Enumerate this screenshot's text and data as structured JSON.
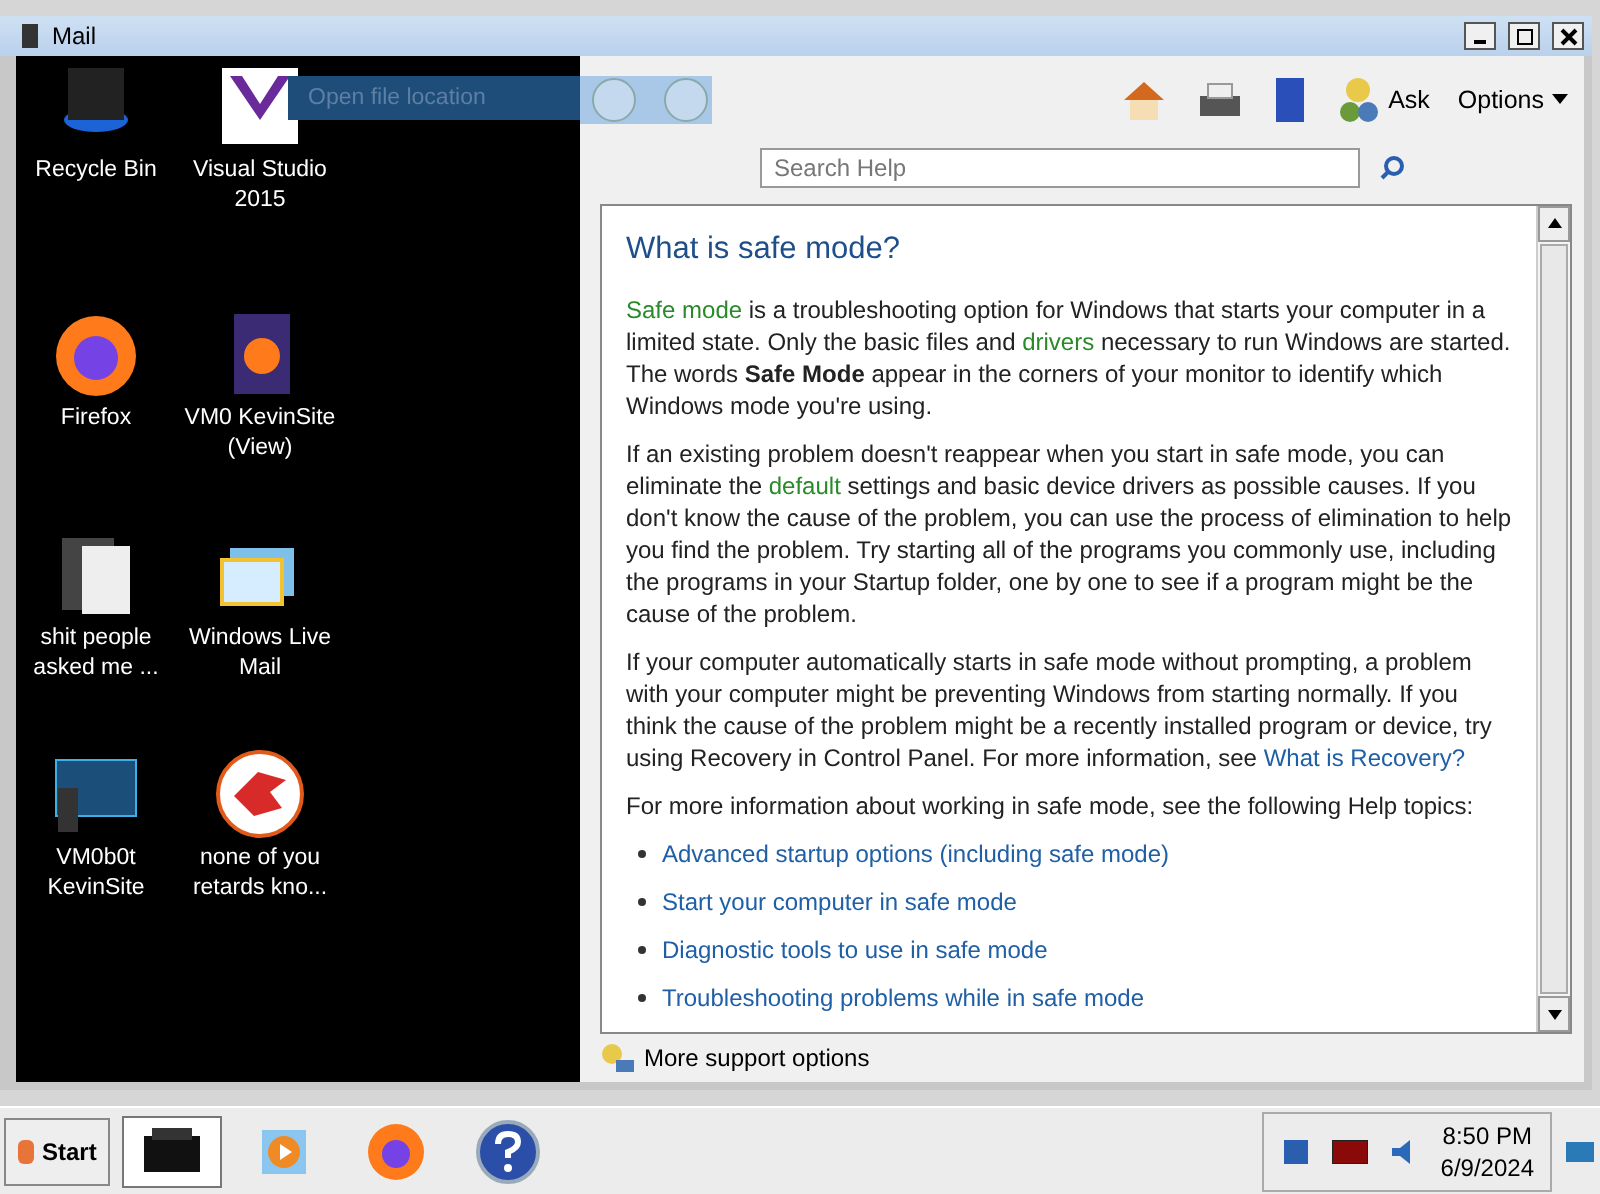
{
  "window": {
    "title": "Mail"
  },
  "desktop": {
    "drag_label": "Open file location",
    "icons": [
      {
        "label": "Recycle Bin",
        "kind": "bin"
      },
      {
        "label": "Visual Studio 2015",
        "kind": "vs"
      },
      {
        "label": "Firefox",
        "kind": "firefox"
      },
      {
        "label": "VM0 KevinSite (View)",
        "kind": "doc"
      },
      {
        "label": "shit people asked me ...",
        "kind": "folder"
      },
      {
        "label": "Windows Live Mail",
        "kind": "mail"
      },
      {
        "label": "VM0b0t KevinSite",
        "kind": "monitor"
      },
      {
        "label": "none of you retards kno...",
        "kind": "dino"
      }
    ]
  },
  "help": {
    "toolbar": {
      "ask": "Ask",
      "options": "Options"
    },
    "search": {
      "placeholder": "Search Help"
    },
    "heading": "What is safe mode?",
    "paragraphs": [
      [
        {
          "kind": "term",
          "text": "Safe mode"
        },
        {
          "kind": "plain",
          "text": " is a troubleshooting option for Windows that starts your computer in a limited state. Only the basic files and "
        },
        {
          "kind": "term",
          "text": "drivers"
        },
        {
          "kind": "plain",
          "text": " necessary to run Windows are started. The words **Safe Mode** appear in the corners of your monitor to identify which Windows mode you're using."
        }
      ],
      [
        {
          "kind": "plain",
          "text": "If an existing problem doesn't reappear when you start in safe mode, you can eliminate the "
        },
        {
          "kind": "term",
          "text": "default"
        },
        {
          "kind": "plain",
          "text": " settings and basic device drivers as possible causes. If you don't know the cause of the problem, you can use the process of elimination to help you find the problem. Try starting all of the programs you commonly use, including the programs in your Startup folder, one by one to see if a program might be the cause of the problem."
        }
      ],
      [
        {
          "kind": "plain",
          "text": "If your computer automatically starts in safe mode without prompting, a problem with your computer might be preventing Windows from starting normally. If you think the cause of the problem might be a recently installed program or device, try using Recovery in Control Panel. For more information, see "
        },
        {
          "kind": "link",
          "text": "What is Recovery?"
        }
      ],
      [
        {
          "kind": "plain",
          "text": "For more information about working in safe mode, see the following Help topics:"
        }
      ]
    ],
    "topics": [
      "Advanced startup options (including safe mode)",
      "Start your computer in safe mode",
      "Diagnostic tools to use in safe mode",
      "Troubleshooting problems while in safe mode"
    ],
    "footer": "More support options"
  },
  "taskbar": {
    "start": "Start",
    "apps": [
      {
        "kind": "printer",
        "selected": true
      },
      {
        "kind": "media",
        "selected": false
      },
      {
        "kind": "firefox",
        "selected": false
      },
      {
        "kind": "help",
        "selected": false
      }
    ],
    "time": "8:50 PM",
    "date": "6/9/2024"
  }
}
